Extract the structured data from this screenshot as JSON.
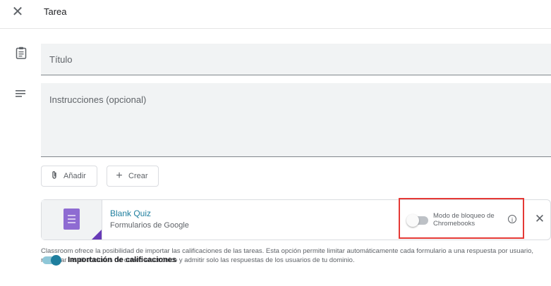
{
  "header": {
    "title": "Tarea",
    "close_icon": "close-icon"
  },
  "form": {
    "title_placeholder": "Título",
    "instructions_placeholder": "Instrucciones (opcional)"
  },
  "actions": {
    "add_label": "Añadir",
    "create_label": "Crear",
    "add_icon": "paperclip-icon",
    "create_icon": "plus-icon"
  },
  "attachment": {
    "title": "Blank Quiz",
    "subtitle": "Formularios de Google",
    "lock_mode_label": "Modo de bloqueo de Chromebooks",
    "lock_mode_enabled": false,
    "info_icon": "info-icon",
    "remove_icon": "close-icon"
  },
  "grades": {
    "notice": "Classroom ofrece la posibilidad de importar las calificaciones de las tareas. Esta opción permite limitar automáticamente cada formulario a una respuesta por usuario, recopilar las direcciones de correo electrónico y admitir solo las respuestas de los usuarios de tu dominio.",
    "import_label": "Importación de calificaciones",
    "import_enabled": true
  },
  "colors": {
    "accent": "#1e7e9e",
    "highlight_border": "#e53935",
    "forms_purple": "#8e6bd2"
  }
}
